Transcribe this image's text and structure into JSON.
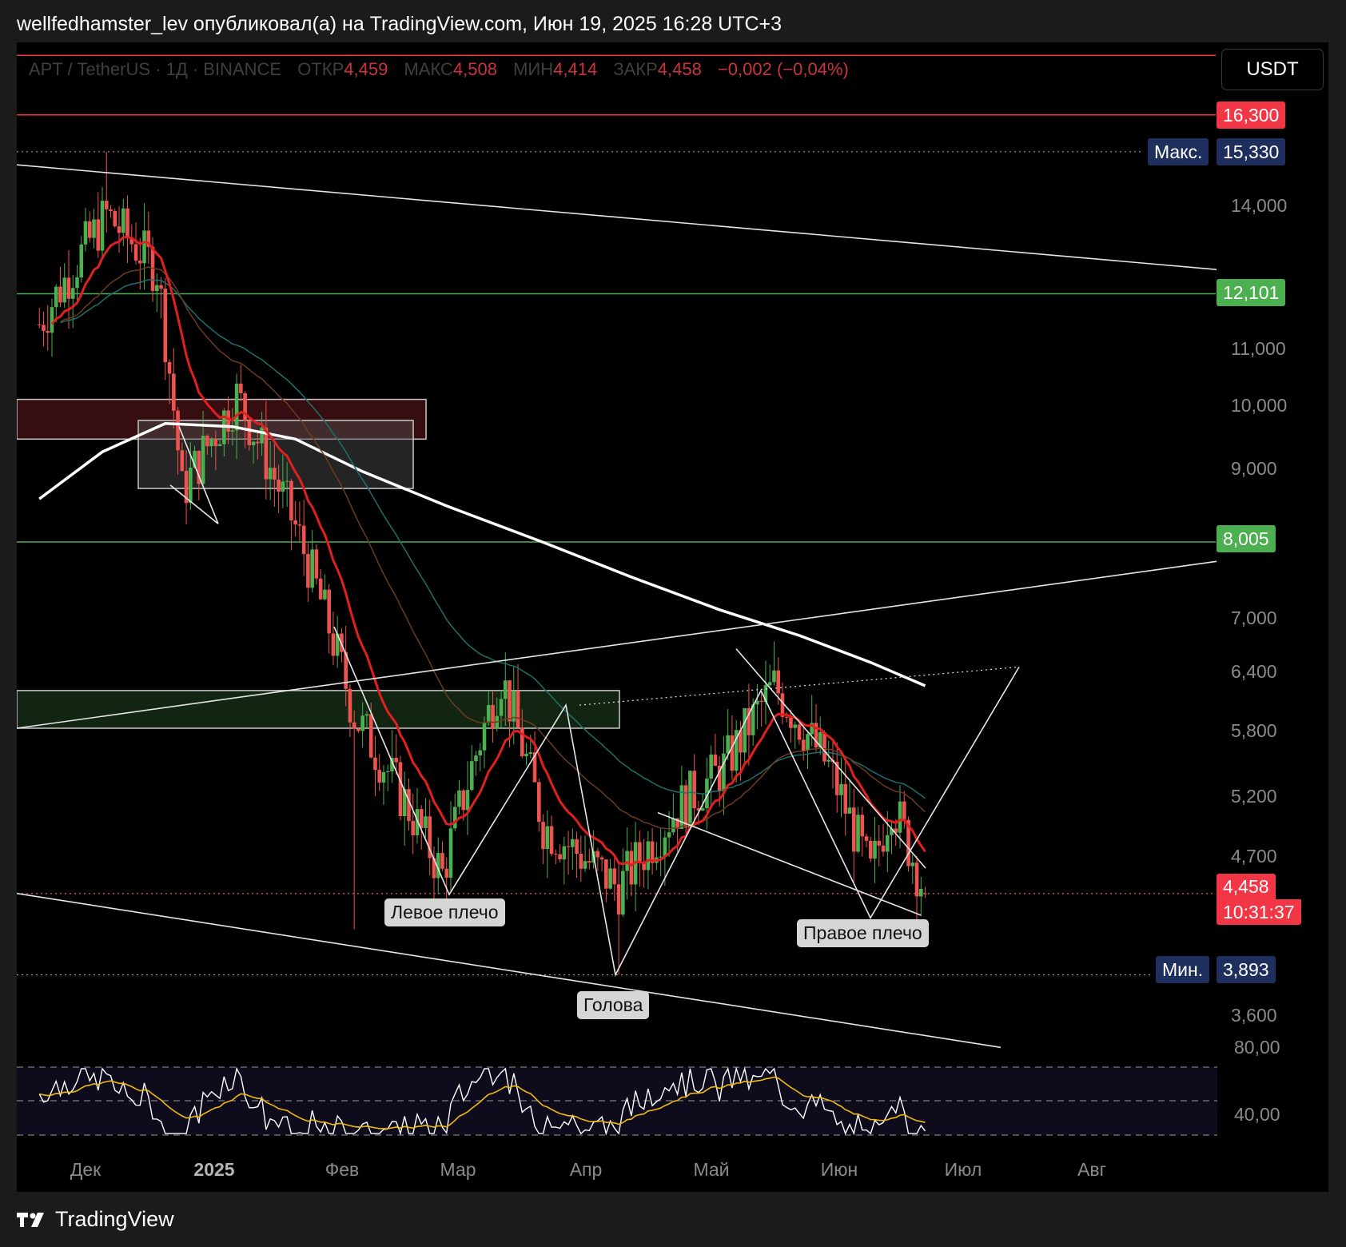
{
  "header": {
    "text": "wellfedhamster_lev опубликовал(а) на TradingView.com, Июн 19, 2025 16:28 UTC+3"
  },
  "legend": {
    "symbol": "APT / TetherUS · 1Д · BINANCE",
    "open_label": "ОТКР",
    "open": "4,459",
    "high_label": "МАКС",
    "high": "4,508",
    "low_label": "МИН",
    "low": "4,414",
    "close_label": "ЗАКР",
    "close": "4,458",
    "change": "−0,002 (−0,04%)"
  },
  "currency_button": "USDT",
  "footer": {
    "brand": "TradingView"
  },
  "colors": {
    "up": "#26a69a",
    "up_candle": "#4caf50",
    "down": "#ef5350",
    "ema_fast": "#e0201f",
    "ema_slow": "#ffffff",
    "resistance": "#f23645",
    "support": "#4caf50",
    "max_tag": "#1e2f5e",
    "rsi": "#ffffff",
    "rsi_ma": "#f0b90b"
  },
  "chart_data": {
    "type": "candlestick",
    "timeframe": "1Д",
    "y_axis": {
      "scale": "log",
      "ticks": [
        "14,000",
        "11,000",
        "10,000",
        "9,000",
        "7,000",
        "6,400",
        "5,800",
        "5,200",
        "4,700",
        "3,600"
      ],
      "range": [
        3.4,
        18.0
      ]
    },
    "x_axis": {
      "ticks": [
        "Дек",
        "2025",
        "Фев",
        "Мар",
        "Апр",
        "Май",
        "Июн",
        "Июл",
        "Авг"
      ]
    },
    "horizontal_levels": [
      {
        "label": "16,300",
        "value": 16.3,
        "kind": "resistance"
      },
      {
        "label": "12,101",
        "value": 12.101,
        "kind": "support"
      },
      {
        "label": "8,005",
        "value": 8.005,
        "kind": "support"
      }
    ],
    "max_marker": {
      "label": "Макс.",
      "value": "15,330"
    },
    "min_marker": {
      "label": "Мин.",
      "value": "3,893"
    },
    "last_price": {
      "value": "4,458",
      "countdown": "10:31:37"
    },
    "pattern_labels": [
      "Левое плечо",
      "Голова",
      "Правое плечо"
    ],
    "ohlc_key_points": [
      {
        "date": "2024-11-20",
        "close": 11.5
      },
      {
        "date": "2024-12-06",
        "high": 15.33,
        "close": 13.8
      },
      {
        "date": "2024-12-18",
        "close": 12.6
      },
      {
        "date": "2024-12-24",
        "close": 8.7
      },
      {
        "date": "2025-01-06",
        "close": 10.2
      },
      {
        "date": "2025-01-20",
        "close": 8.2
      },
      {
        "date": "2025-02-03",
        "close": 6.0
      },
      {
        "date": "2025-02-24",
        "close": 4.6
      },
      {
        "date": "2025-03-10",
        "close": 6.4
      },
      {
        "date": "2025-03-20",
        "close": 5.0
      },
      {
        "date": "2025-04-07",
        "low": 3.893,
        "close": 4.5
      },
      {
        "date": "2025-04-20",
        "close": 5.1
      },
      {
        "date": "2025-05-02",
        "close": 5.5
      },
      {
        "date": "2025-05-14",
        "close": 6.3
      },
      {
        "date": "2025-05-27",
        "close": 5.5
      },
      {
        "date": "2025-06-06",
        "close": 4.6
      },
      {
        "date": "2025-06-11",
        "close": 5.2
      },
      {
        "date": "2025-06-19",
        "open": 4.459,
        "high": 4.508,
        "low": 4.414,
        "close": 4.458
      }
    ],
    "rsi": {
      "axis_ticks": [
        "80,00",
        "40,00"
      ],
      "last_value_approx": 41
    }
  }
}
